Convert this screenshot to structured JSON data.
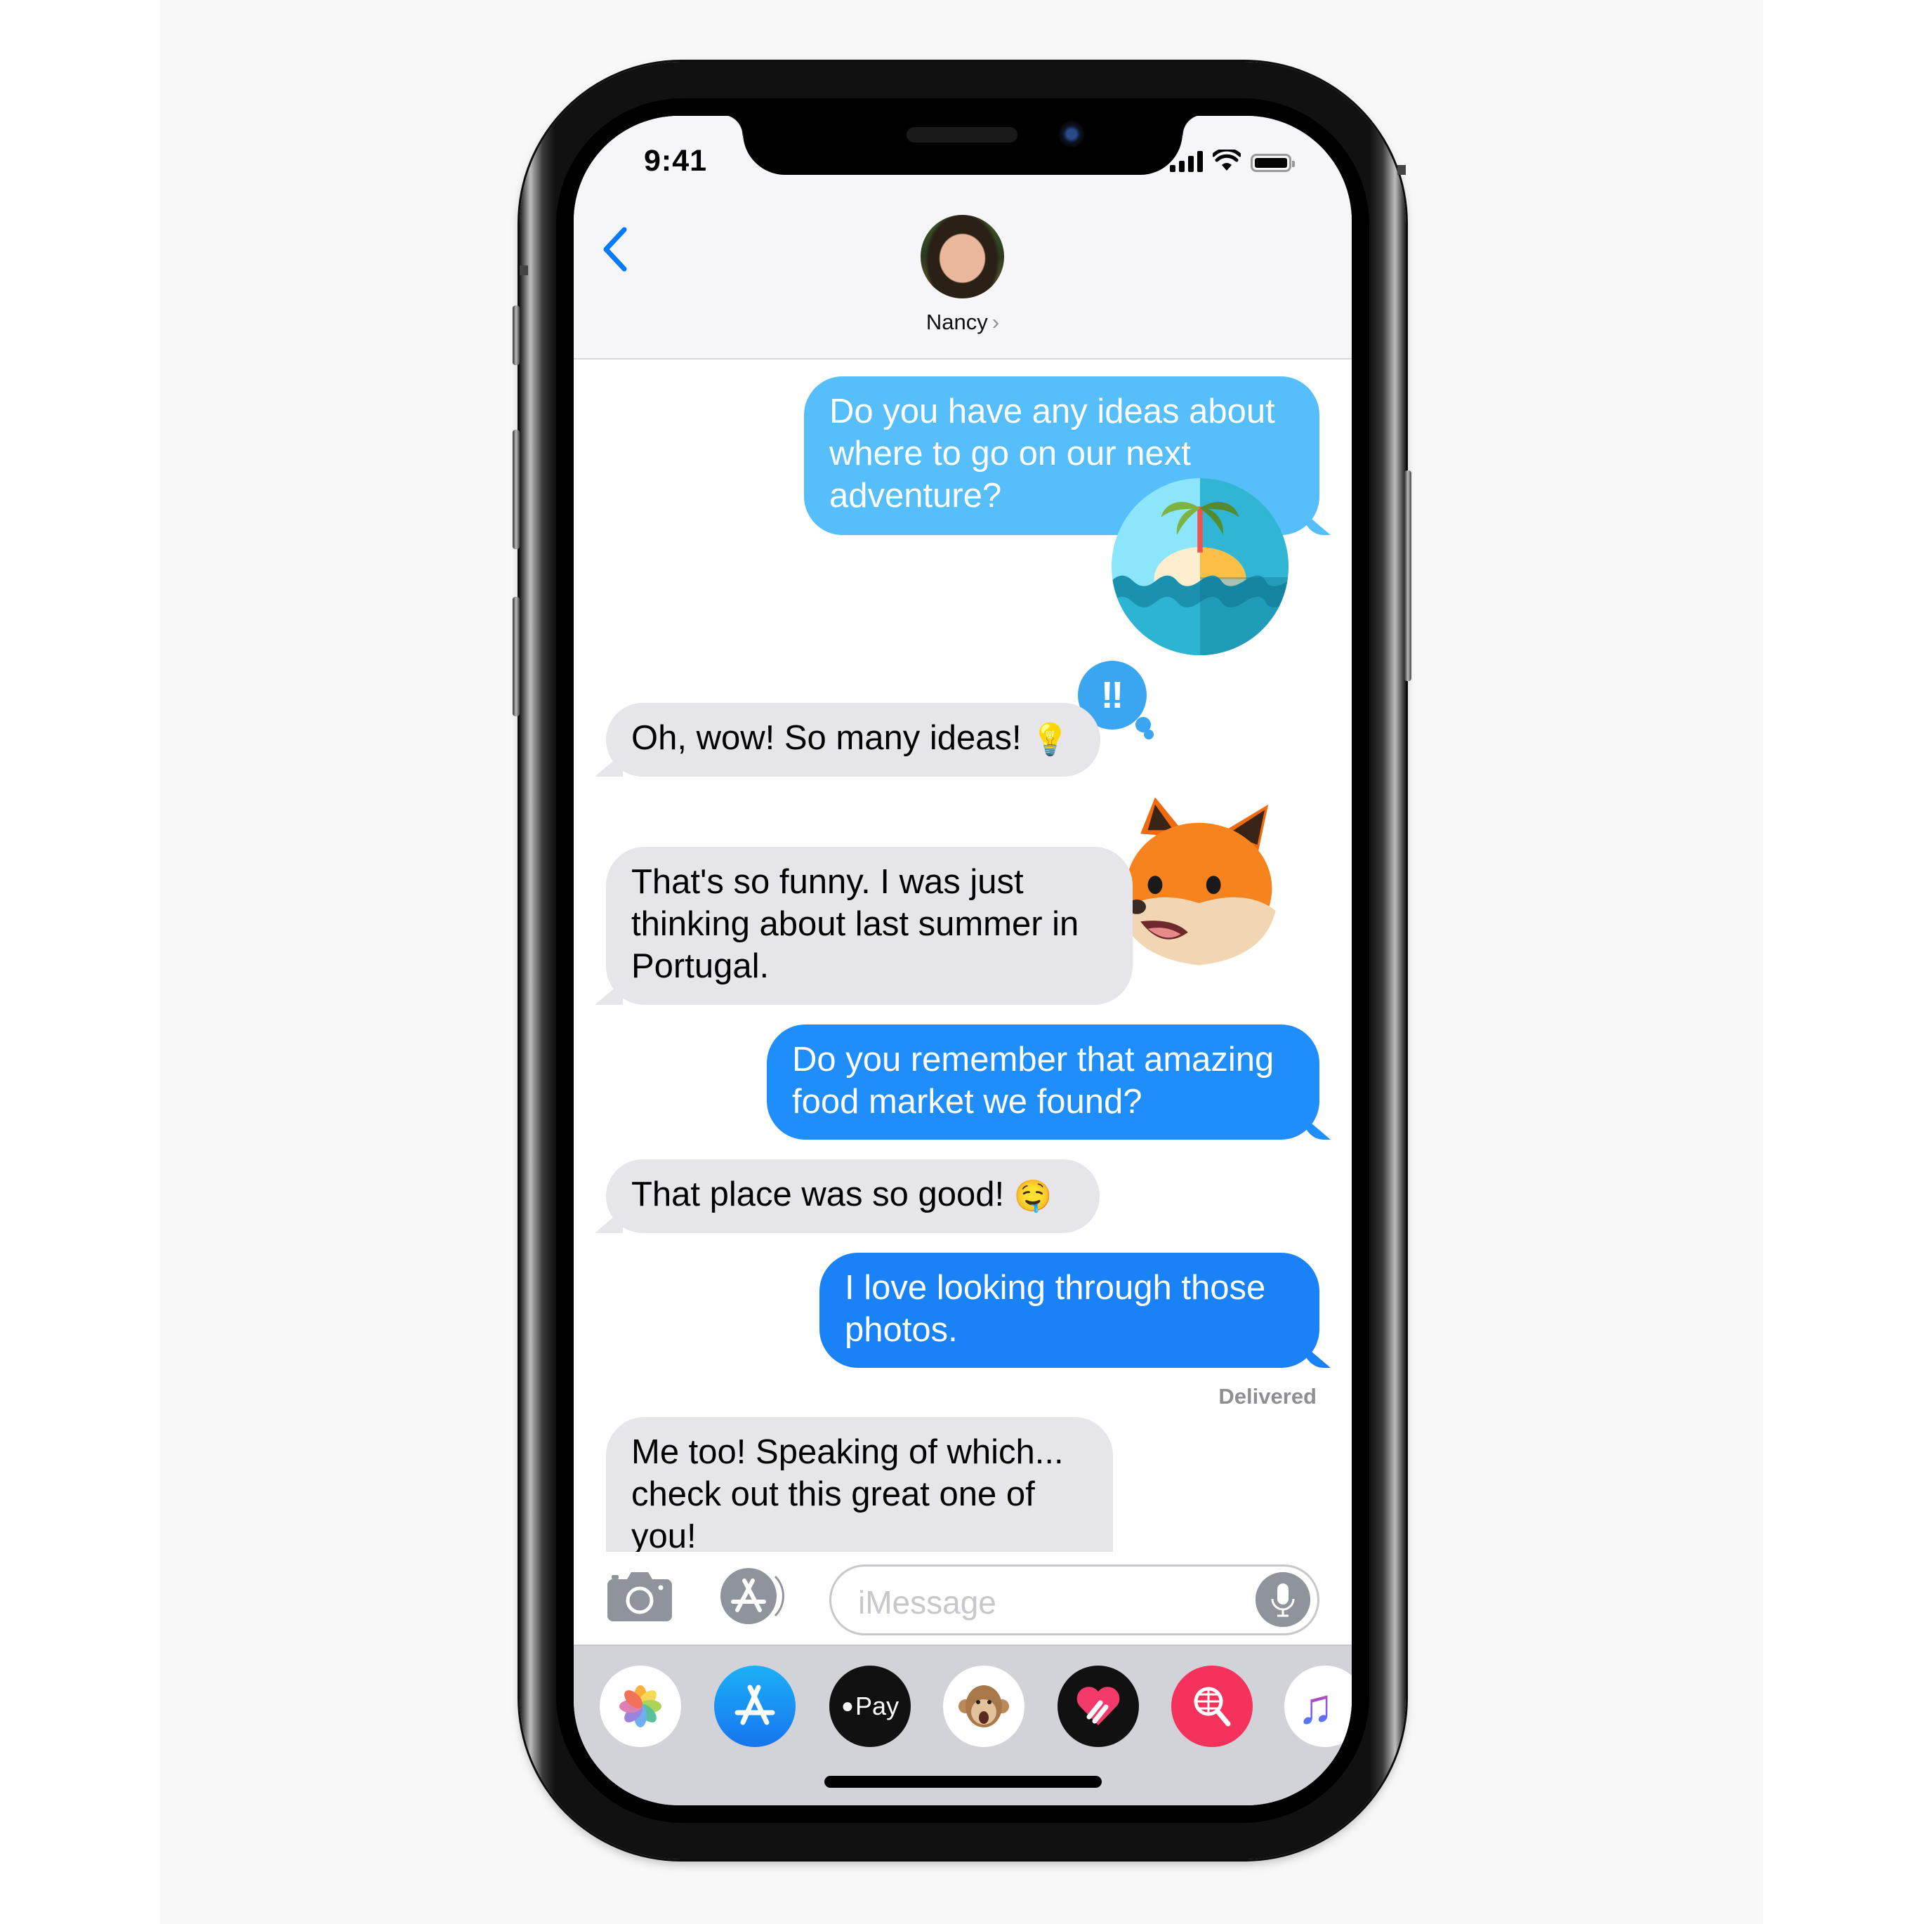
{
  "status_bar": {
    "time": "9:41",
    "icons": [
      "signal-icon",
      "wifi-icon",
      "battery-icon"
    ]
  },
  "nav": {
    "back_icon": "chevron-left-icon",
    "contact_name": "Nancy",
    "contact_chevron": "›"
  },
  "messages": [
    {
      "direction": "outgoing",
      "text": "Do you have any ideas about where to go on our next adventure?",
      "color": "#5ac8fa",
      "attachment": "island-sticker"
    },
    {
      "direction": "incoming",
      "text": "Oh, wow! So many ideas!",
      "emoji": "💡",
      "tapback": "‼"
    },
    {
      "direction": "incoming",
      "text": "That's so funny. I was just thinking about last summer in Portugal.",
      "attachment": "fox-animoji"
    },
    {
      "direction": "outgoing",
      "text": "Do you remember that amazing food market we found?",
      "color": "#1f8efa"
    },
    {
      "direction": "incoming",
      "text": "That place was so good!",
      "emoji": "🤤"
    },
    {
      "direction": "outgoing",
      "text": "I love looking through those photos.",
      "color": "#1a82f7",
      "status": "Delivered"
    },
    {
      "direction": "incoming",
      "text": "Me too! Speaking of which... check out this great one of you!"
    }
  ],
  "input": {
    "placeholder": "iMessage",
    "camera_icon": "camera-icon",
    "apps_icon": "app-store-icon",
    "mic_icon": "microphone-icon"
  },
  "app_drawer": [
    {
      "name": "Photos",
      "icon": "photos-icon"
    },
    {
      "name": "App Store",
      "icon": "app-store-icon"
    },
    {
      "name": "Apple Pay",
      "icon": "apple-pay-icon",
      "label": "Pay"
    },
    {
      "name": "Animoji",
      "icon": "monkey-animoji-icon"
    },
    {
      "name": "Digital Touch",
      "icon": "digital-touch-heart-icon"
    },
    {
      "name": "Search Images",
      "icon": "globe-search-icon"
    },
    {
      "name": "Music",
      "icon": "music-note-icon",
      "glyph": "♫"
    }
  ],
  "colors": {
    "ios_blue": "#007aff",
    "incoming_bubble": "#e5e5ea",
    "drawer_bg": "#d1d3d9"
  }
}
